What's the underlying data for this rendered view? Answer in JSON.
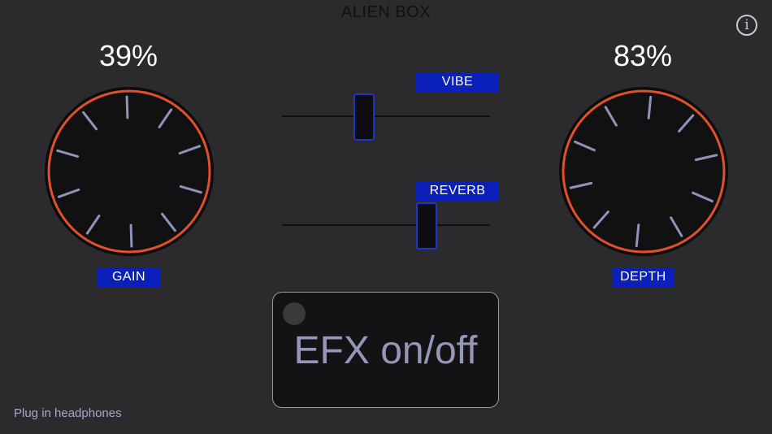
{
  "app": {
    "title": "ALIEN BOX",
    "info_glyph": "i",
    "status_text": "Plug in headphones"
  },
  "colors": {
    "background": "#2b2b2d",
    "knob_ring": "#e0502a",
    "knob_tick": "#8e93b9",
    "label_bg": "#0b1fba",
    "slider_thumb_border": "#1e36c8"
  },
  "knobs": [
    {
      "id": "gain",
      "label": "GAIN",
      "value_text": "39%",
      "value": 0.39
    },
    {
      "id": "depth",
      "label": "DEPTH",
      "value_text": "83%",
      "value": 0.83
    }
  ],
  "sliders": [
    {
      "id": "vibe",
      "label": "VIBE",
      "value": 0.39
    },
    {
      "id": "reverb",
      "label": "REVERB",
      "value": 0.69
    }
  ],
  "efx_button": {
    "label": "EFX on/off",
    "active": false
  },
  "icons": {
    "info": "info-circle-icon",
    "led": "led-indicator-icon"
  }
}
